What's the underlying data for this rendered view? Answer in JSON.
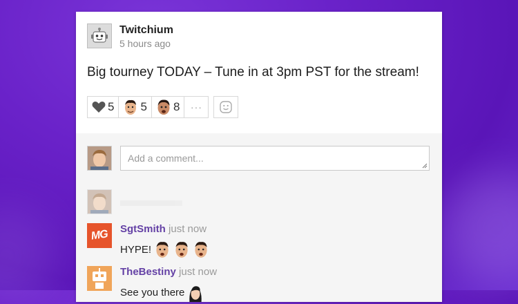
{
  "post": {
    "author": "Twitchium",
    "time": "5 hours ago",
    "message": "Big tourney TODAY – Tune in at 3pm PST for the stream!",
    "reactions": [
      {
        "icon": "heart-icon",
        "count": "5"
      },
      {
        "icon": "kappa-emote-icon",
        "count": "5"
      },
      {
        "icon": "biblethump-emote-icon",
        "count": "8"
      }
    ],
    "more_label": "···"
  },
  "compose": {
    "placeholder": "Add a comment..."
  },
  "comments": [
    {
      "author": "SgtSmith",
      "when": "just now",
      "text": "HYPE!",
      "avatar": "mg-logo"
    },
    {
      "author": "TheBestiny",
      "when": "just now",
      "text": "See you there",
      "avatar": "robot-avatar"
    }
  ],
  "colors": {
    "accent": "#6441a5",
    "background": "#6a22c9",
    "mg_logo": "#e6542b",
    "robot_avatar": "#f0a55a"
  }
}
